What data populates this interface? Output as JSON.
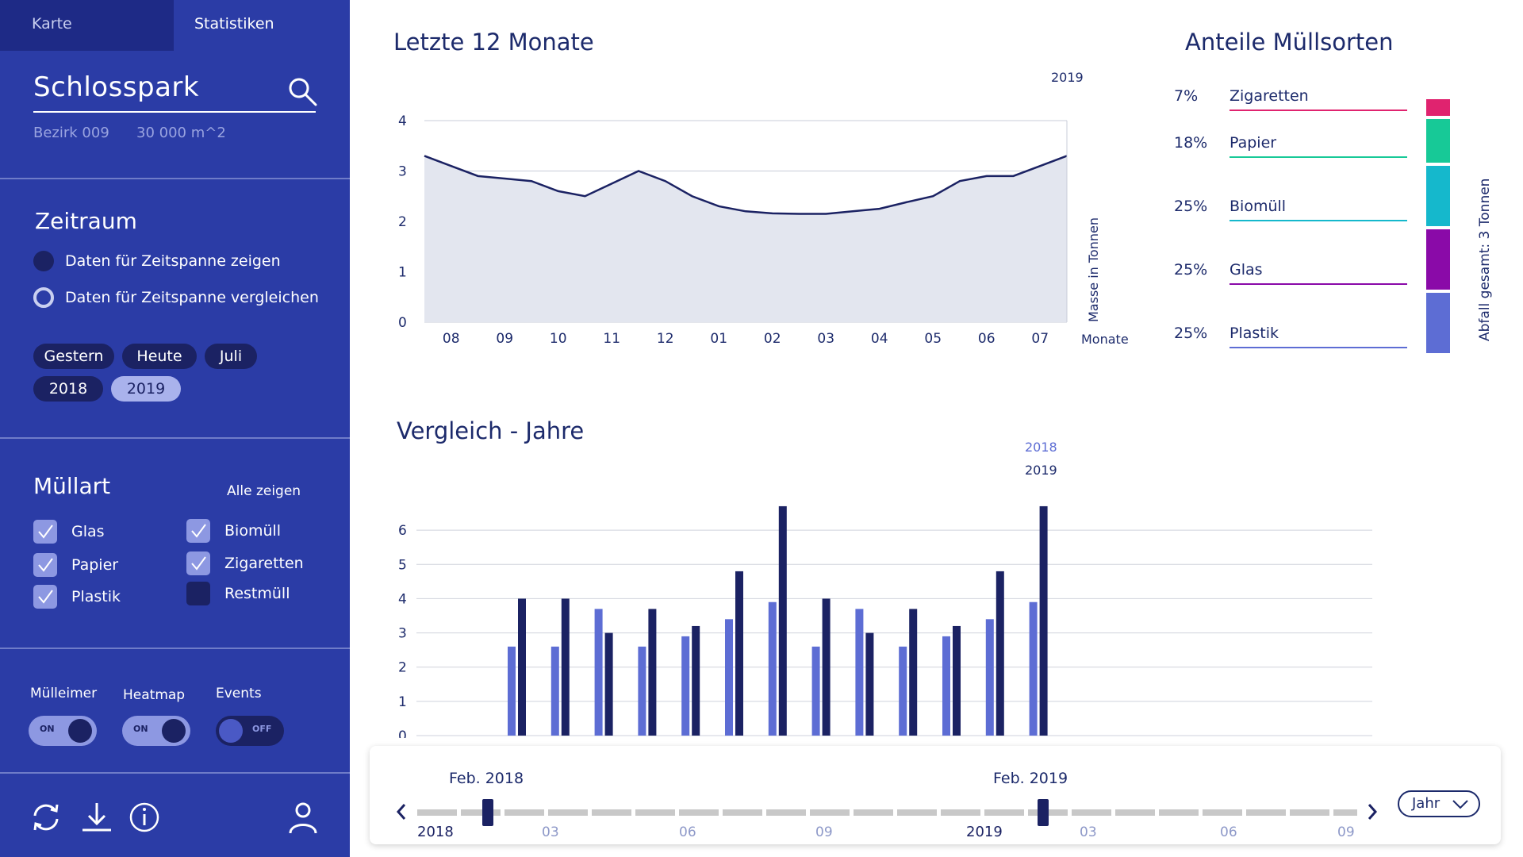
{
  "tabs": {
    "karte": "Karte",
    "statistiken": "Statistiken"
  },
  "place": {
    "name": "Schlosspark",
    "district": "Bezirk 009",
    "area": "30 000 m^2"
  },
  "period": {
    "title": "Zeitraum",
    "option_show": "Daten für Zeitspanne zeigen",
    "option_compare": "Daten für Zeitspanne vergleichen",
    "chips": [
      "Gestern",
      "Heute",
      "Juli",
      "2018",
      "2019"
    ],
    "active_chip": "2019"
  },
  "waste": {
    "title": "Müllart",
    "show_all": "Alle zeigen",
    "types": [
      {
        "label": "Glas",
        "checked": true
      },
      {
        "label": "Papier",
        "checked": true
      },
      {
        "label": "Plastik",
        "checked": true
      },
      {
        "label": "Biomüll",
        "checked": true
      },
      {
        "label": "Zigaretten",
        "checked": true
      },
      {
        "label": "Restmüll",
        "checked": false
      }
    ]
  },
  "toggles": [
    {
      "label": "Mülleimer",
      "state": "ON"
    },
    {
      "label": "Heatmap",
      "state": "ON"
    },
    {
      "label": "Events",
      "state": "OFF"
    }
  ],
  "bottom_icons": [
    "refresh-icon",
    "download-icon",
    "info-icon",
    "user-icon"
  ],
  "colors": {
    "sidebar": "#2b3ca6",
    "navy": "#1b2263",
    "light_blue": "#5d6dd4",
    "zigaretten": "#e0236f",
    "papier": "#17c997",
    "biomuell": "#15b8cc",
    "glas": "#8a0aa8",
    "plastik": "#5d6dd4"
  },
  "chart_data": [
    {
      "type": "area",
      "title": "Letzte 12 Monate",
      "year_label": "2019",
      "xlabel": "Monate",
      "ylabel": "Masse in Tonnen",
      "ylim": [
        0,
        4
      ],
      "yticks": [
        0,
        1,
        2,
        3,
        4
      ],
      "categories": [
        "08",
        "09",
        "10",
        "11",
        "12",
        "01",
        "02",
        "03",
        "04",
        "05",
        "06",
        "07"
      ],
      "x": [
        0,
        0.5,
        1,
        1.5,
        2,
        2.5,
        3,
        3.5,
        4,
        4.5,
        5,
        5.5,
        6,
        6.5,
        7,
        7.5,
        8,
        8.5,
        9,
        9.5,
        10,
        10.5,
        11,
        11.5,
        12
      ],
      "values": [
        3.3,
        3.1,
        2.9,
        2.85,
        2.8,
        2.6,
        2.5,
        2.75,
        3.0,
        2.8,
        2.5,
        2.3,
        2.2,
        2.16,
        2.15,
        2.15,
        2.2,
        2.25,
        2.38,
        2.5,
        2.8,
        2.9,
        2.9,
        3.1,
        3.3
      ]
    },
    {
      "type": "bar",
      "title": "Vergleich - Jahre",
      "ylim": [
        0,
        7
      ],
      "yticks": [
        0,
        1,
        2,
        3,
        4,
        5,
        6
      ],
      "series": [
        {
          "name": "2018",
          "values": [
            2.6,
            2.6,
            3.7,
            2.6,
            2.9,
            3.4,
            3.9,
            2.6,
            3.7,
            2.6,
            2.9,
            3.4,
            3.9
          ]
        },
        {
          "name": "2019",
          "values": [
            4.0,
            4.0,
            3.0,
            3.7,
            3.2,
            4.8,
            6.7,
            4.0,
            3.0,
            3.7,
            3.2,
            4.8,
            6.7
          ]
        }
      ]
    },
    {
      "type": "bar",
      "title": "Anteile Müllsorten",
      "total_label": "Abfall gesamt: 3 Tonnen",
      "categories": [
        "Zigaretten",
        "Papier",
        "Biomüll",
        "Glas",
        "Plastik"
      ],
      "values": [
        7,
        18,
        25,
        25,
        25
      ],
      "value_labels": [
        "7%",
        "18%",
        "25%",
        "25%",
        "25%"
      ]
    }
  ],
  "timeline": {
    "start_label": "Feb. 2018",
    "end_label": "Feb. 2019",
    "ticks": [
      "2018",
      "03",
      "06",
      "09",
      "2019",
      "03",
      "06",
      "09"
    ],
    "unit_select": "Jahr"
  }
}
